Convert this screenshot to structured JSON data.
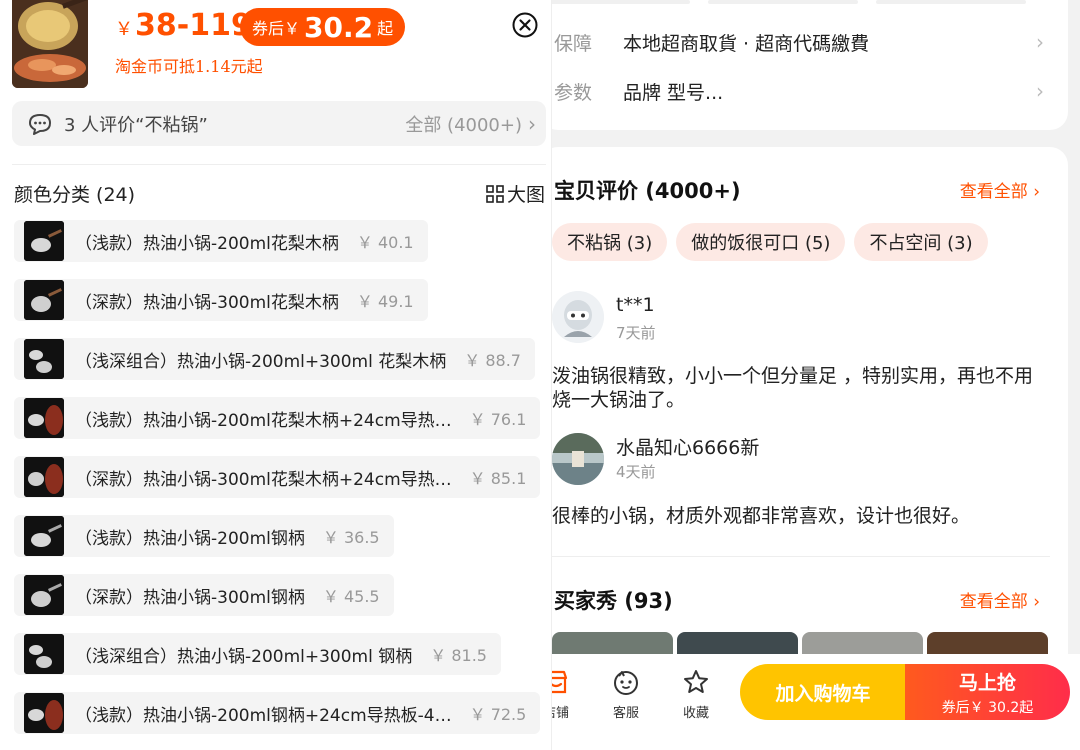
{
  "right": {
    "guarantee": {
      "key": "保障",
      "value": "本地超商取貨 · 超商代碼繳費",
      "chevron": "›"
    },
    "params": {
      "key": "参数",
      "value": "品牌 型号...",
      "chevron": "›"
    },
    "reviews": {
      "title": "宝贝评价 (4000+)",
      "see_all": "查看全部 ›",
      "tags": [
        "不粘锅 (3)",
        "做的饭很可口 (5)",
        "不占空间 (3)"
      ],
      "items": [
        {
          "name": "t**1",
          "time": "7天前",
          "text": "泼油锅很精致，小小一个但分量足 ，特别实用，再也不用烧一大锅油了。"
        },
        {
          "name": "水晶知心6666新",
          "time": "4天前",
          "text": "很棒的小锅，材质外观都非常喜欢，设计也很好。"
        }
      ]
    },
    "buyer_show": {
      "title": "买家秀 (93)",
      "see_all": "查看全部 ›"
    }
  },
  "bottom_bar": {
    "shop": "店铺",
    "service": "客服",
    "favorite": "收藏",
    "add_to_cart": "加入购物车",
    "buy_now": "马上抢",
    "buy_now_sub": "券后￥ 30.2起",
    "accent": "#ff5000"
  },
  "sku_sheet": {
    "currency": "￥",
    "price_range": "38-119",
    "coupon_label": "券后￥",
    "coupon_price": "30.2",
    "coupon_suffix": "起",
    "coin_note": "淘金币可抵1.14元起",
    "review_hint": "3 人评价“不粘锅”",
    "review_all": "全部 (4000+)",
    "review_chevron": "›",
    "category_title": "颜色分类 (24)",
    "big_image": "大图",
    "skus": [
      {
        "name": "（浅款）热油小锅-200ml花梨木柄",
        "price": "￥ 40.1"
      },
      {
        "name": "（深款）热油小锅-300ml花梨木柄",
        "price": "￥ 49.1"
      },
      {
        "name": "（浅深组合）热油小锅-200ml+300ml 花梨木柄",
        "price": "￥ 88.7"
      },
      {
        "name": "（浅款）热油小锅-200ml花梨木柄+24cm导热…",
        "price": "￥ 76.1"
      },
      {
        "name": "（深款）热油小锅-300ml花梨木柄+24cm导热…",
        "price": "￥ 85.1"
      },
      {
        "name": "（浅款）热油小锅-200ml钢柄",
        "price": "￥ 36.5"
      },
      {
        "name": "（深款）热油小锅-300ml钢柄",
        "price": "￥ 45.5"
      },
      {
        "name": "（浅深组合）热油小锅-200ml+300ml 钢柄",
        "price": "￥ 81.5"
      },
      {
        "name": "（浅款）热油小锅-200ml钢柄+24cm导热板-4…",
        "price": "￥ 72.5"
      }
    ]
  }
}
